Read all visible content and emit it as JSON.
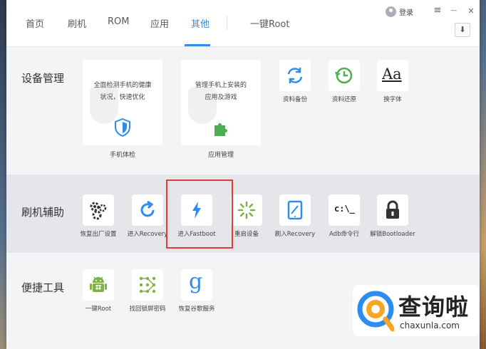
{
  "tabs": [
    {
      "label": "首页"
    },
    {
      "label": "刷机"
    },
    {
      "label": "ROM"
    },
    {
      "label": "应用"
    },
    {
      "label": "其他"
    }
  ],
  "root_tab": "一键Root",
  "login": "登录",
  "window_buttons": {
    "menu": "≡",
    "minimize": "—",
    "close": "✕",
    "download": "⬇"
  },
  "device_management": {
    "title": "设备管理",
    "card1": {
      "line1": "全面检测手机的健康",
      "line2": "状况，快速优化",
      "label": "手机体检"
    },
    "card2": {
      "line1": "管理手机上安装的",
      "line2": "应用及游戏",
      "label": "应用管理"
    },
    "tiles": [
      {
        "label": "资料备份",
        "icon": "sync-icon"
      },
      {
        "label": "资料还原",
        "icon": "clock-restore-icon"
      },
      {
        "label": "换字体",
        "icon": "font-icon",
        "glyph": "Aa"
      }
    ]
  },
  "flash_assist": {
    "title": "刷机辅助",
    "tiles": [
      {
        "label": "恢复出厂设置",
        "icon": "gears-icon"
      },
      {
        "label": "进入Recovery",
        "icon": "refresh-icon"
      },
      {
        "label": "进入Fastboot",
        "icon": "lightning-icon"
      },
      {
        "label": "重启设备",
        "icon": "spinner-icon"
      },
      {
        "label": "刷入Recovery",
        "icon": "tablet-icon"
      },
      {
        "label": "Adb命令行",
        "icon": "terminal-icon",
        "glyph": "c:\\_"
      },
      {
        "label": "解锁Bootloader",
        "icon": "lock-icon"
      }
    ]
  },
  "quick_tools": {
    "title": "便捷工具",
    "tiles": [
      {
        "label": "一键Root",
        "icon": "android-icon"
      },
      {
        "label": "找回锁屏密码",
        "icon": "pattern-lock-icon"
      },
      {
        "label": "恢复谷歌服务",
        "icon": "google-icon",
        "glyph": "g"
      }
    ]
  },
  "watermark": {
    "cn": "查询啦",
    "en": "chaxunla.com"
  },
  "colors": {
    "accent": "#2d8cf0",
    "highlight": "#e23b3b",
    "android": "#7cb342",
    "refresh": "#2d8cf0",
    "restore": "#4caf50"
  }
}
